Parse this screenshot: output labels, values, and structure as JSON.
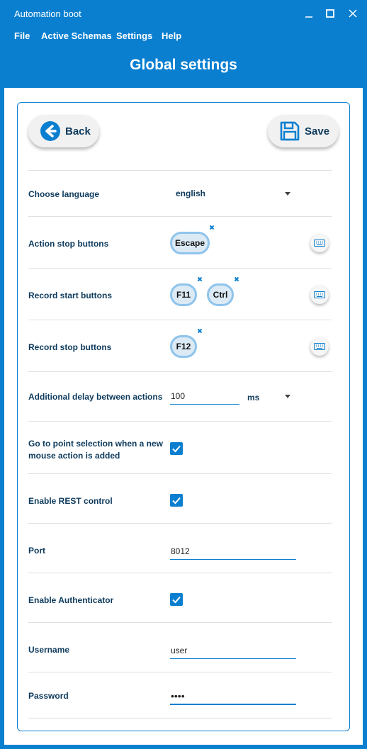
{
  "window": {
    "title": "Automation boot",
    "controls": [
      "minimize-icon",
      "maximize-icon",
      "close-icon"
    ]
  },
  "menu": {
    "file": "File",
    "active_schemas": "Active Schemas",
    "settings": "Settings",
    "help": "Help"
  },
  "header": {
    "title": "Global settings"
  },
  "toolbar": {
    "back_label": "Back",
    "save_label": "Save",
    "back_icon": "arrow-left-circle-icon",
    "save_icon": "floppy-disk-icon"
  },
  "settings": {
    "language": {
      "label": "Choose language",
      "value": "english"
    },
    "action_stop": {
      "label": "Action stop buttons",
      "keys": [
        "Escape"
      ]
    },
    "record_start": {
      "label": "Record start buttons",
      "keys": [
        "F11",
        "Ctrl"
      ]
    },
    "record_stop": {
      "label": "Record stop buttons",
      "keys": [
        "F12"
      ]
    },
    "delay": {
      "label": "Additional delay between actions",
      "value": "100",
      "unit": "ms"
    },
    "point_selection": {
      "label_line1": "Go to point selection when a new",
      "label_line2": "mouse action is added",
      "checked": true
    },
    "rest_control": {
      "label": "Enable REST control",
      "checked": true
    },
    "port": {
      "label": "Port",
      "value": "8012"
    },
    "authenticator": {
      "label": "Enable Authenticator",
      "checked": true
    },
    "username": {
      "label": "Username",
      "value": "user"
    },
    "password": {
      "label": "Password",
      "value": "abcd"
    }
  },
  "colors": {
    "accent": "#0a7fd0",
    "chip_fill": "#dceaf5",
    "chip_border": "#8ec4ec",
    "text": "#0d3a5c"
  }
}
